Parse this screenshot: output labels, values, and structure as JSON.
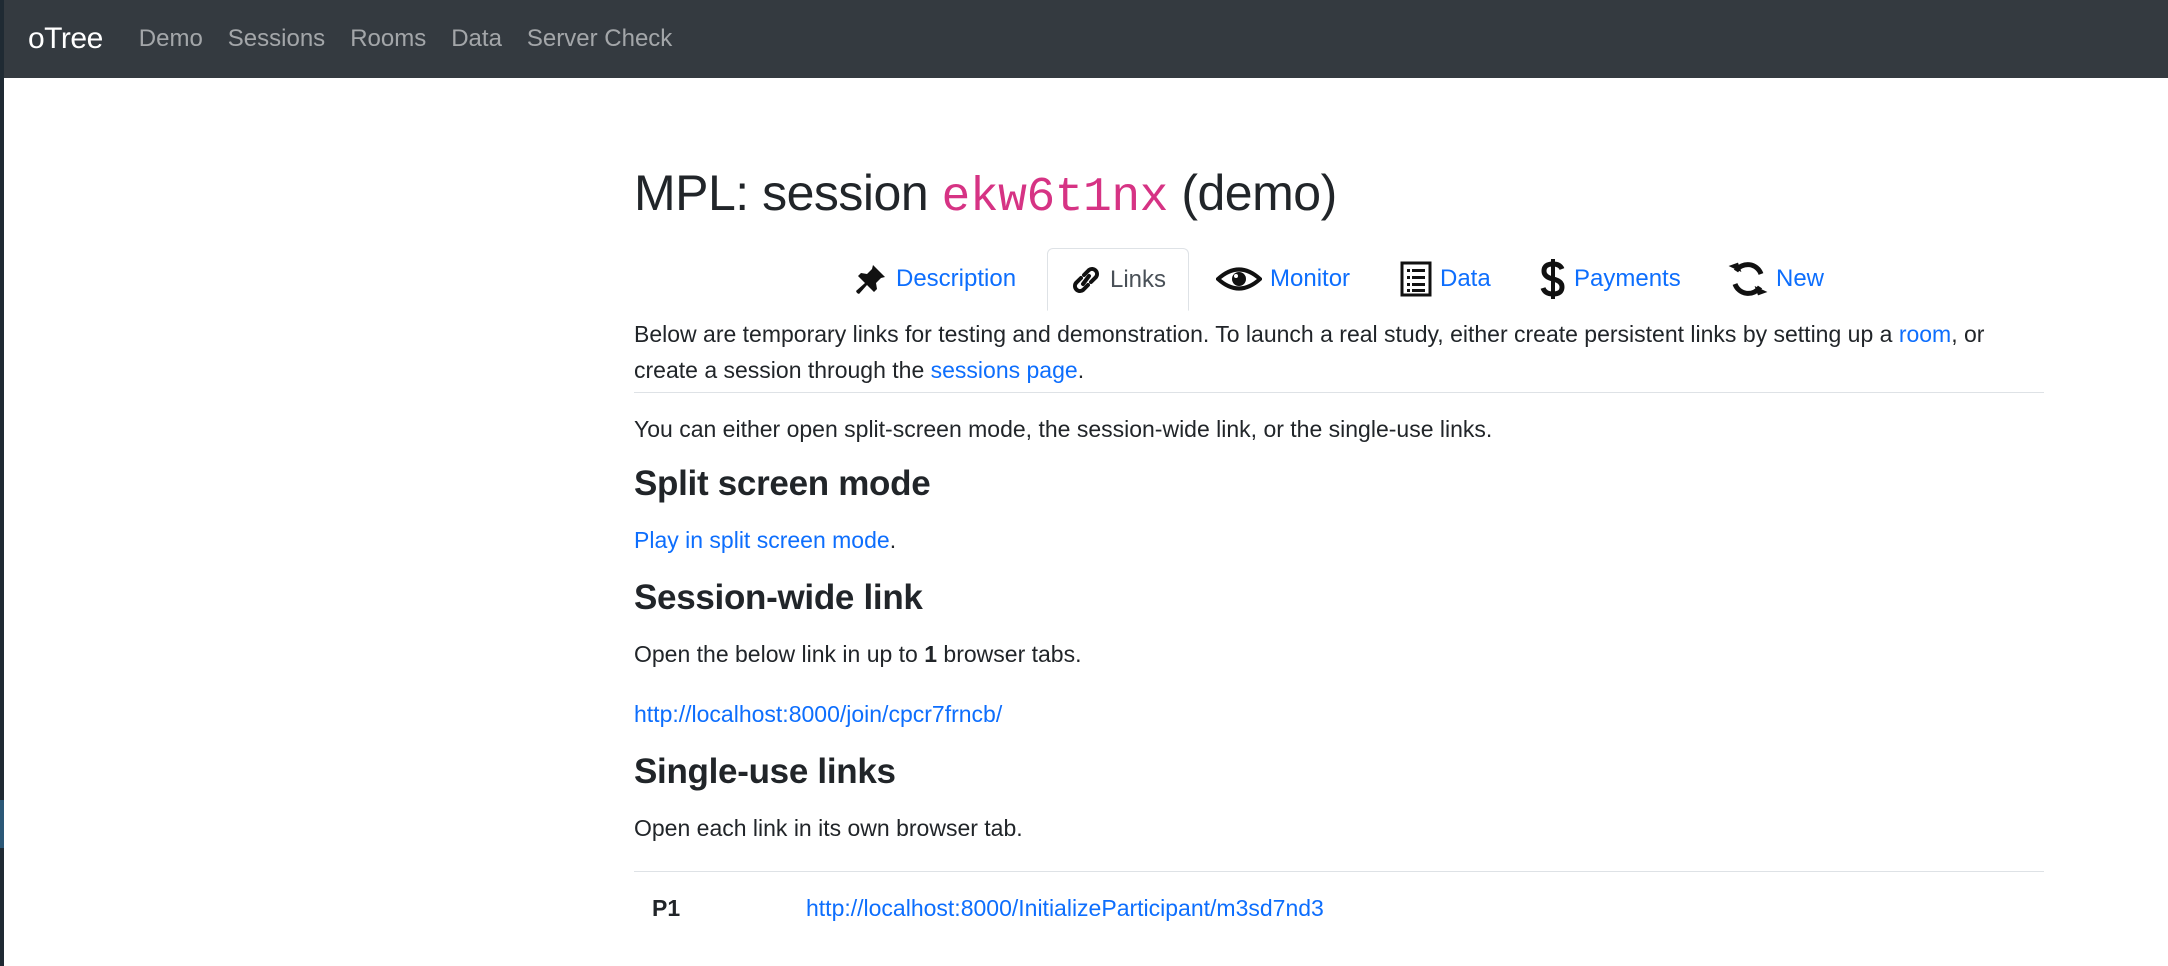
{
  "navbar": {
    "brand": "oTree",
    "links": [
      "Demo",
      "Sessions",
      "Rooms",
      "Data",
      "Server Check"
    ]
  },
  "header": {
    "title_prefix": "MPL: session ",
    "session_code": "ekw6t1nx",
    "title_suffix": " (demo)"
  },
  "tabs": [
    {
      "label": "Description",
      "icon": "pin-icon",
      "active": false
    },
    {
      "label": "Links",
      "icon": "link-icon",
      "active": true
    },
    {
      "label": "Monitor",
      "icon": "eye-icon",
      "active": false
    },
    {
      "label": "Data",
      "icon": "list-icon",
      "active": false
    },
    {
      "label": "Payments",
      "icon": "dollar-icon",
      "active": false
    },
    {
      "label": "New",
      "icon": "refresh-icon",
      "active": false
    }
  ],
  "intro": {
    "text1": "Below are temporary links for testing and demonstration. To launch a real study, either create persistent links by setting up a ",
    "room_link": "room",
    "text2": ", or create a session through the ",
    "sessions_link": "sessions page",
    "text3": "."
  },
  "either_text": "You can either open split-screen mode, the session-wide link, or the single-use links.",
  "split": {
    "heading": "Split screen mode",
    "link": "Play in split screen mode",
    "suffix": "."
  },
  "session_wide": {
    "heading": "Session-wide link",
    "text_before": "Open the below link in up to ",
    "count": "1",
    "text_after": " browser tabs.",
    "url": "http://localhost:8000/join/cpcr7frncb/"
  },
  "single_use": {
    "heading": "Single-use links",
    "text": "Open each link in its own browser tab.",
    "rows": [
      {
        "participant": "P1",
        "url": "http://localhost:8000/InitializeParticipant/m3sd7nd3"
      }
    ]
  },
  "colors": {
    "navbar_bg": "#343a40",
    "link": "#0d6efd",
    "code": "#d63384"
  }
}
